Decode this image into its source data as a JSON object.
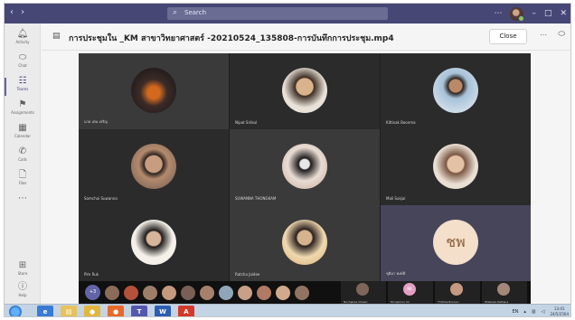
{
  "titlebar": {
    "search_placeholder": "Search"
  },
  "rail": [
    {
      "label": "Activity",
      "icon": "bell-icon"
    },
    {
      "label": "Chat",
      "icon": "chat-icon"
    },
    {
      "label": "Teams",
      "icon": "teams-icon"
    },
    {
      "label": "Assignments",
      "icon": "assignments-icon"
    },
    {
      "label": "Calendar",
      "icon": "calendar-icon"
    },
    {
      "label": "Calls",
      "icon": "calls-icon"
    },
    {
      "label": "Files",
      "icon": "files-icon"
    },
    {
      "label": "Store",
      "icon": "store-icon"
    },
    {
      "label": "Help",
      "icon": "help-icon"
    }
  ],
  "header": {
    "title": "การประชุมใน _KM สาขาวิทยาศาสตร์ -20210524_135808-การบันทึกการประชุม.mp4",
    "close_label": "Close"
  },
  "tiles": [
    {
      "name": "นาย เด่น เจริญ",
      "initials": "",
      "avatar_color": "#8a3f2a"
    },
    {
      "name": "Nipat Sirikul",
      "initials": "",
      "avatar_color": "#d9b38c"
    },
    {
      "name": "Kittisak Boonma",
      "initials": "",
      "avatar_color": "#a7c2d9"
    },
    {
      "name": "Somchai Suwanna",
      "initials": "",
      "avatar_color": "#c89c7e"
    },
    {
      "name": "SUWANNA THONGKAM",
      "initials": "",
      "avatar_color": "#c7a998"
    },
    {
      "name": "Mali Sukjai",
      "initials": "",
      "avatar_color": "#d8b49a"
    },
    {
      "name": "Pim Ruk",
      "initials": "",
      "avatar_color": "#5a4a45"
    },
    {
      "name": "Ratcha Jaidee",
      "initials": "",
      "avatar_color": "#d6b38f"
    },
    {
      "name": "ชุติมา พงษ์ดี",
      "initials": "ชพ",
      "avatar_color": "#f3dfca"
    }
  ],
  "strip": {
    "more_label": "+3",
    "mini_avatars": [
      "#8b6b5a",
      "#b5503a",
      "#9d7d6a",
      "#c49a7c",
      "#7a5f55",
      "#a6806b",
      "#8fa6b8",
      "#c99f88",
      "#b07a64",
      "#d1a98c",
      "#927362"
    ],
    "people": [
      {
        "name": "Nuchjaree Chaisri",
        "color": "#7f655a",
        "initials": ""
      },
      {
        "name": "Pornpimon Sri",
        "color": "#e3a0c2",
        "initials": "BK"
      },
      {
        "name": "Thitima Boonsri",
        "color": "#c59a80",
        "initials": ""
      },
      {
        "name": "Wilaiwan Rattana",
        "color": "#a5877a",
        "initials": ""
      }
    ]
  },
  "taskbar": {
    "lang": "EN",
    "time": "13:41",
    "date": "24/5/2564"
  }
}
